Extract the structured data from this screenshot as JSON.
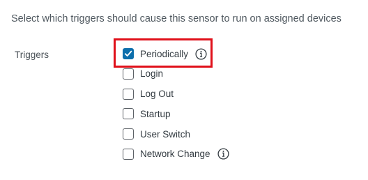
{
  "description": "Select which triggers should cause this sensor to run on assigned devices",
  "triggers": {
    "label": "Triggers",
    "options": [
      {
        "label": "Periodically",
        "checked": true,
        "has_info": true
      },
      {
        "label": "Login",
        "checked": false,
        "has_info": false
      },
      {
        "label": "Log Out",
        "checked": false,
        "has_info": false
      },
      {
        "label": "Startup",
        "checked": false,
        "has_info": false
      },
      {
        "label": "User Switch",
        "checked": false,
        "has_info": false
      },
      {
        "label": "Network Change",
        "checked": false,
        "has_info": true
      }
    ]
  },
  "icons": {
    "checked": "checkmark-icon",
    "info": "info-circle-icon"
  },
  "colors": {
    "checkbox_checked": "#0d6fac",
    "checkbox_border": "#5c6166",
    "highlight": "#e0101a",
    "text": "#333b41"
  }
}
